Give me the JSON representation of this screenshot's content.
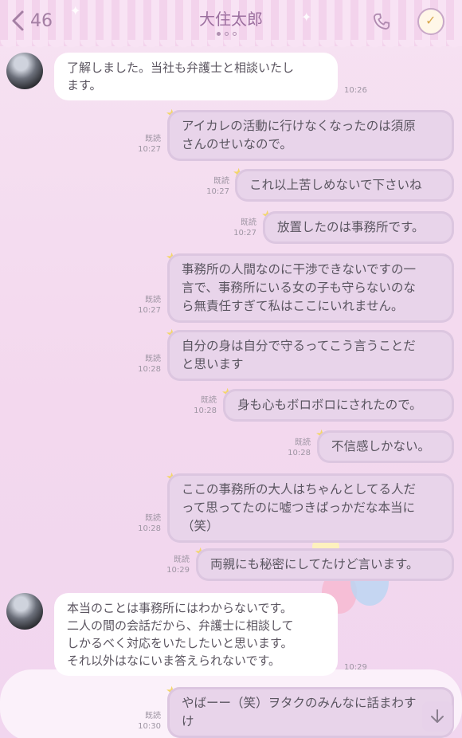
{
  "header": {
    "back_count": "46",
    "title": "大住太郎"
  },
  "messages": [
    {
      "dir": "in",
      "text": "了解しました。当社も弁護士と相談いたし\nます。",
      "time": "10:26"
    },
    {
      "dir": "out",
      "text": "アイカレの活動に行けなくなったのは須原\nさんのせいなので。",
      "read": "既読",
      "time": "10:27"
    },
    {
      "dir": "out",
      "text": "これ以上苦しめないで下さいね",
      "read": "既読",
      "time": "10:27"
    },
    {
      "dir": "out",
      "text": "放置したのは事務所です。",
      "read": "既読",
      "time": "10:27"
    },
    {
      "dir": "out",
      "text": "事務所の人間なのに干渉できないですの一\n言で、事務所にいる女の子も守らないのな\nら無責任すぎて私はここにいれません。",
      "read": "既読",
      "time": "10:27"
    },
    {
      "dir": "out",
      "text": "自分の身は自分で守るってこう言うことだ\nと思います",
      "read": "既読",
      "time": "10:28"
    },
    {
      "dir": "out",
      "text": "身も心もボロボロにされたので。",
      "read": "既読",
      "time": "10:28"
    },
    {
      "dir": "out",
      "text": "不信感しかない。",
      "read": "既読",
      "time": "10:28"
    },
    {
      "dir": "out",
      "text": "ここの事務所の大人はちゃんとしてる人だ\nって思ってたのに嘘つきばっかだな本当に\n（笑）",
      "read": "既読",
      "time": "10:28"
    },
    {
      "dir": "out",
      "text": "両親にも秘密にしてたけど言います。",
      "read": "既読",
      "time": "10:29"
    },
    {
      "dir": "in",
      "text": "本当のことは事務所にはわからないです。\n二人の間の会話だから、弁護士に相談して\nしかるべく対応をいたしたいと思います。\nそれ以外はなにいま答えられないです。",
      "time": "10:29"
    },
    {
      "dir": "out",
      "text": "やばーー（笑）ヲタクのみんなに話まわす\nけ",
      "read": "既読",
      "time": "10:30"
    }
  ],
  "icons": {
    "back": "chevron-left-icon",
    "phone": "phone-icon",
    "menu": "check-badge-icon",
    "scroll": "arrow-down-icon"
  },
  "colors": {
    "background": "#f4dcef",
    "bubble_out": "#e8d4ea",
    "bubble_in": "#ffffff",
    "accent_star": "#f3d66a"
  }
}
